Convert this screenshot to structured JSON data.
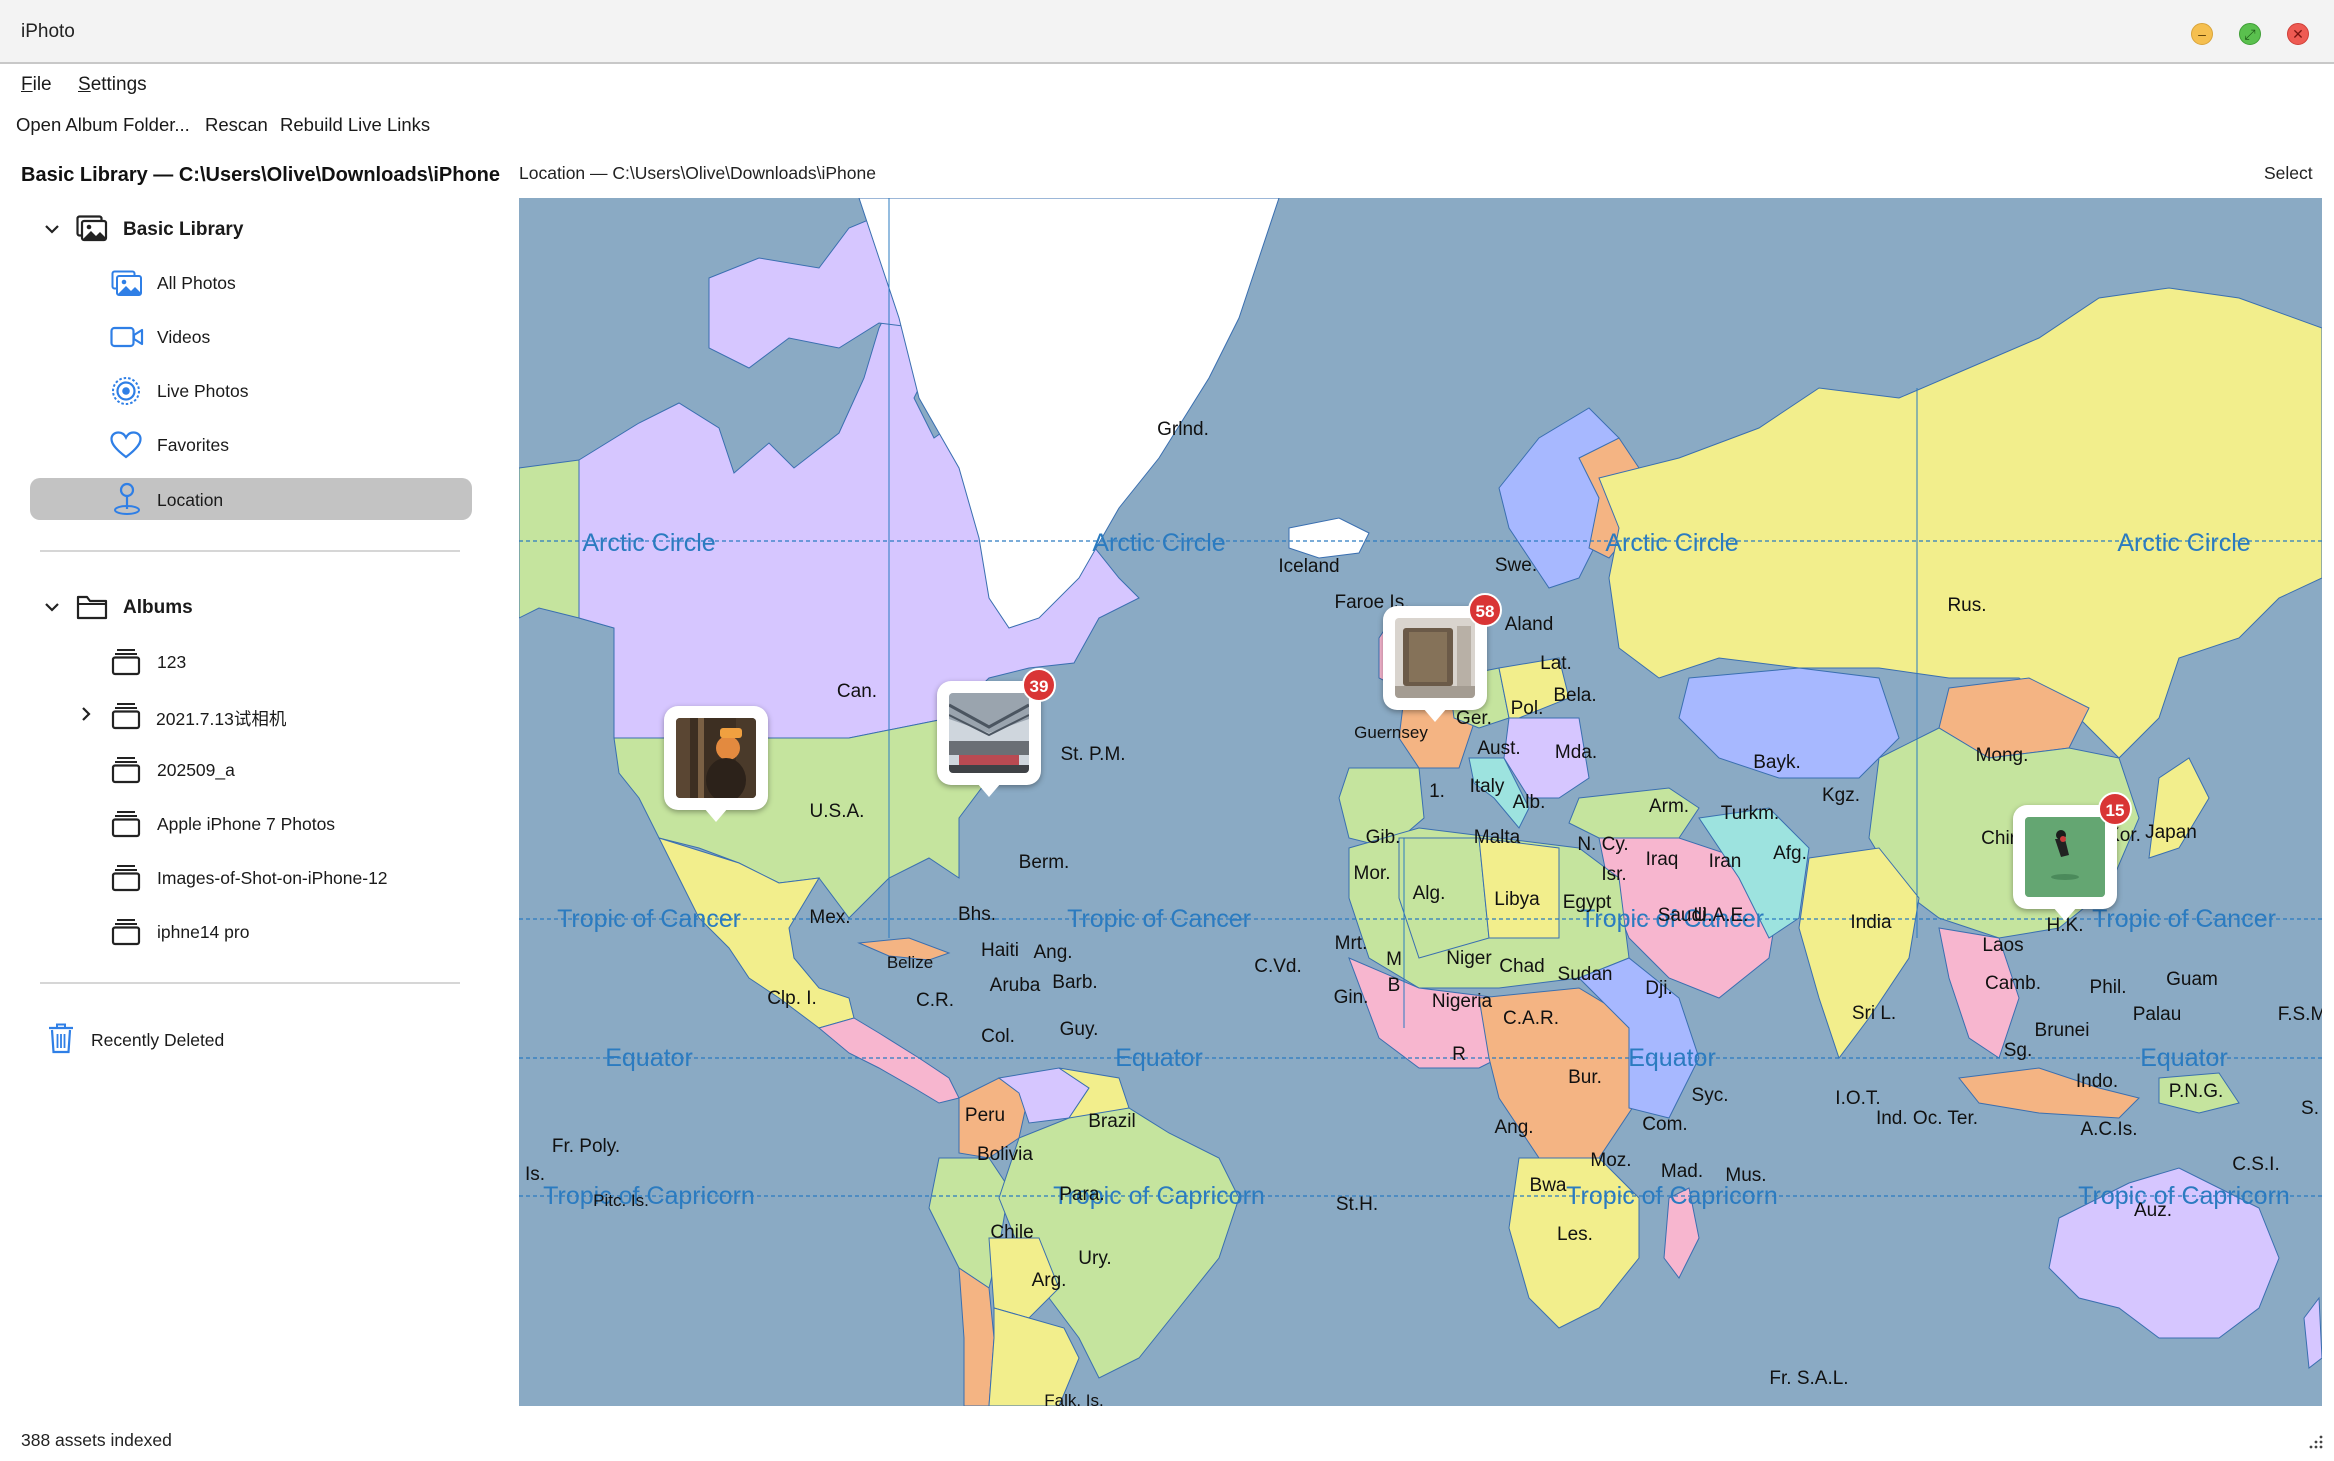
{
  "window": {
    "title": "iPhoto",
    "controls": [
      "minimize-icon",
      "maximize-icon",
      "close-icon"
    ]
  },
  "menu": {
    "file": {
      "label": "File",
      "mnemonic": "F",
      "rest": "ile"
    },
    "settings": {
      "label": "Settings",
      "mnemonic": "S",
      "rest": "ettings"
    }
  },
  "toolbar": {
    "open_album_folder": "Open Album Folder...",
    "rescan": "Rescan",
    "rebuild_live_links": "Rebuild Live Links"
  },
  "sidebar": {
    "header": "Basic Library — C:\\Users\\Olive\\Downloads\\iPhone",
    "library": {
      "label": "Basic Library",
      "icon": "photo-library-icon",
      "items": [
        {
          "label": "All Photos",
          "icon": "photos-icon"
        },
        {
          "label": "Videos",
          "icon": "video-camera-icon"
        },
        {
          "label": "Live Photos",
          "icon": "live-photo-icon"
        },
        {
          "label": "Favorites",
          "icon": "heart-icon"
        },
        {
          "label": "Location",
          "icon": "location-pin-icon",
          "selected": true
        }
      ]
    },
    "albums": {
      "label": "Albums",
      "icon": "folder-icon",
      "items": [
        {
          "label": "123"
        },
        {
          "label": "2021.7.13试相机",
          "expandable": true
        },
        {
          "label": "202509_a"
        },
        {
          "label": "Apple iPhone 7 Photos"
        },
        {
          "label": "Images-of-Shot-on-iPhone-12"
        },
        {
          "label": "iphne14 pro"
        }
      ]
    },
    "recently_deleted": {
      "label": "Recently Deleted",
      "icon": "trash-icon"
    }
  },
  "content": {
    "header": "Location — C:\\Users\\Olive\\Downloads\\iPhone",
    "select_label": "Select"
  },
  "map": {
    "pins": [
      {
        "name": "pin-us-west",
        "count": ""
      },
      {
        "name": "pin-us-east",
        "count": "39"
      },
      {
        "name": "pin-europe",
        "count": "58"
      },
      {
        "name": "pin-china",
        "count": "15"
      }
    ],
    "latitude_lines": [
      "Arctic Circle",
      "Tropic of Cancer",
      "Equator",
      "Tropic of Capricorn"
    ],
    "labels": [
      "Grlnd.",
      "Iceland",
      "Faroe Is.",
      "Swe.",
      "Aland",
      "Lat.",
      "Bela.",
      "Pol.",
      "Ger.",
      "Guernsey",
      "Aust.",
      "Mda.",
      "Italy",
      "Alb.",
      "Arm.",
      "Can.",
      "U.S.A.",
      "St. P.M.",
      "Berm.",
      "Mex.",
      "Bhs.",
      "Haiti",
      "Ang.",
      "Barb.",
      "Aruba",
      "Clp. I.",
      "C.R.",
      "Belize",
      "Col.",
      "Guy.",
      "Peru",
      "Brazil",
      "Bolivia",
      "Para.",
      "Chile",
      "Ury.",
      "Arg.",
      "Fr. Poly.",
      "Pitc. Is.",
      "Is.",
      "Falk. Is.",
      "St.H.",
      "C.Vd.",
      "Mrt.",
      "Gin.",
      "Alg.",
      "Libya",
      "Egypt",
      "Malta",
      "N. Cy.",
      "Isr.",
      "Iraq",
      "Iran",
      "Afg.",
      "Turkm.",
      "Kgz.",
      "Bayk.",
      "Mong.",
      "Rus.",
      "China",
      "S.Kor.",
      "Japan",
      "H.K.",
      "Laos",
      "Camb.",
      "Phil.",
      "Guam",
      "Palau",
      "Brunei",
      "Sg.",
      "Indo.",
      "P.N.G.",
      "A.C.Is.",
      "C.S.I.",
      "Auz.",
      "F.S.M",
      "S.",
      "India",
      "Sri L.",
      "I.O.T.",
      "Ind. Oc. Ter.",
      "Syc.",
      "Com.",
      "Mad.",
      "Mus.",
      "Moz.",
      "Bwa",
      "Les.",
      "Ang.",
      "Bur.",
      "C.A.R.",
      "Chad",
      "Sudan",
      "Dji.",
      "Niger",
      "Nigeria",
      "Mor.",
      "Gib.",
      "Saudi",
      "U.A.E.",
      "Fr. S.A.L.",
      "R",
      "1.",
      "M",
      "B"
    ],
    "colors": {
      "ocean": "#8aaac4",
      "purple": "#d6c6ff",
      "yellow": "#f2ee8c",
      "green": "#c5e49e",
      "orange": "#f4b483",
      "blue": "#a7b8ff",
      "pink": "#f7b6cf",
      "teal": "#9de3df",
      "greenland": "#ffffff",
      "line_label": "#2b7bc0"
    }
  },
  "status": {
    "text": "388 assets indexed"
  }
}
